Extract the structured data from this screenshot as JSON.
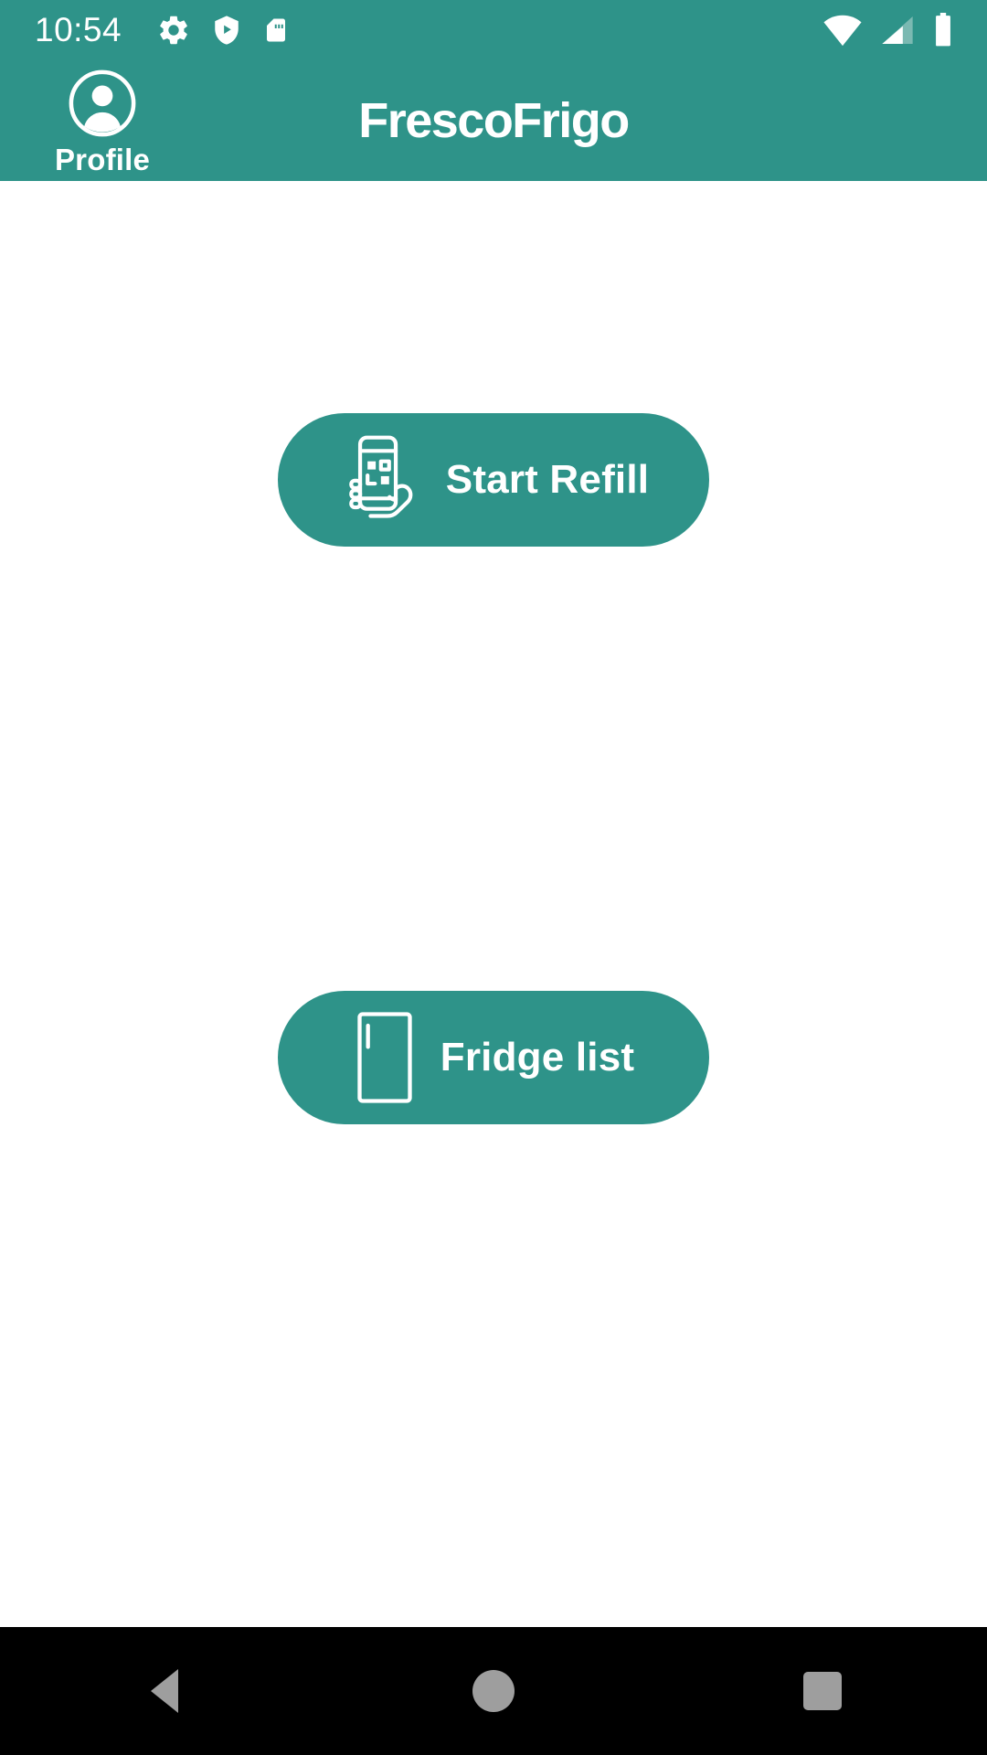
{
  "theme": {
    "accent": "#2e9389",
    "on_accent": "#ffffff",
    "page_background": "#ffffff",
    "navbar_background": "#000000",
    "navbar_icon": "#9e9e9e"
  },
  "status_bar": {
    "clock": "10:54",
    "left_icons": [
      "gear-icon",
      "shield-play-icon",
      "sd-card-icon"
    ],
    "right_icons": [
      "wifi-icon",
      "cellular-signal-icon",
      "battery-icon"
    ],
    "wifi_level": "full",
    "cellular_bars_filled": 2,
    "cellular_bars_total": 4,
    "battery_level": "full"
  },
  "app_bar": {
    "title": "FrescoFrigo",
    "profile": {
      "label": "Profile",
      "icon": "account-circle-icon"
    }
  },
  "main": {
    "buttons": [
      {
        "id": "start-refill",
        "label": "Start Refill",
        "icon": "hand-holding-phone-qr-icon"
      },
      {
        "id": "fridge-list",
        "label": "Fridge list",
        "icon": "refrigerator-icon"
      }
    ]
  },
  "nav_bar": {
    "items": [
      {
        "id": "back",
        "icon": "back-triangle-icon"
      },
      {
        "id": "home",
        "icon": "home-circle-icon"
      },
      {
        "id": "recents",
        "icon": "recents-square-icon"
      }
    ]
  }
}
